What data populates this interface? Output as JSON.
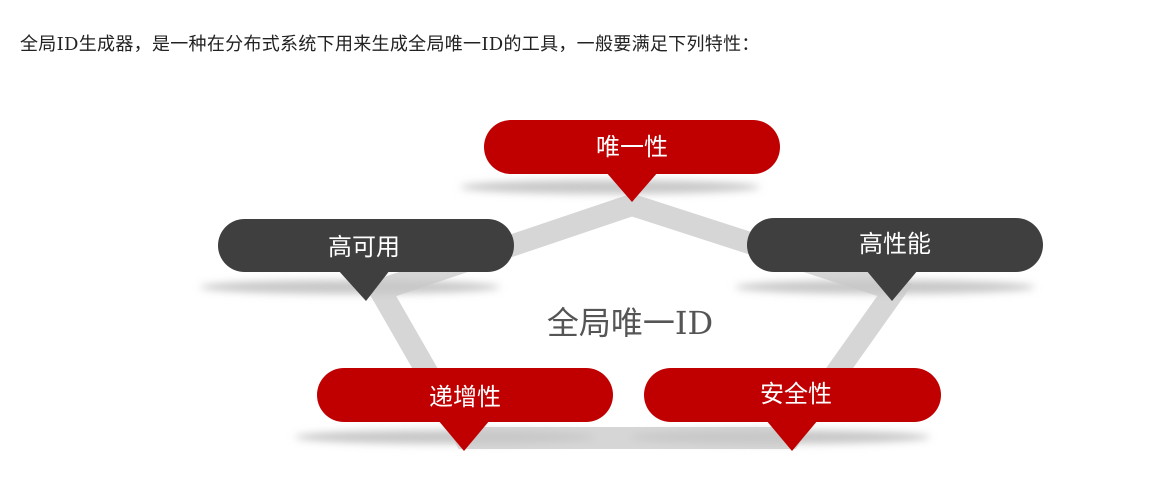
{
  "intro_text": "全局ID生成器，是一种在分布式系统下用来生成全局唯一ID的工具，一般要满足下列特性：",
  "diagram": {
    "center_label": "全局唯一ID",
    "colors": {
      "red": "#c00000",
      "dark": "#3f3f3f",
      "pentagon": "#d6d6d6",
      "shadow": "#c8c8c8",
      "text": "#ffffff"
    },
    "callouts": [
      {
        "id": "uniqueness",
        "label": "唯一性",
        "color": "red"
      },
      {
        "id": "high-availability",
        "label": "高可用",
        "color": "dark"
      },
      {
        "id": "high-performance",
        "label": "高性能",
        "color": "dark"
      },
      {
        "id": "incremental",
        "label": "递增性",
        "color": "red"
      },
      {
        "id": "security",
        "label": "安全性",
        "color": "red"
      }
    ]
  }
}
